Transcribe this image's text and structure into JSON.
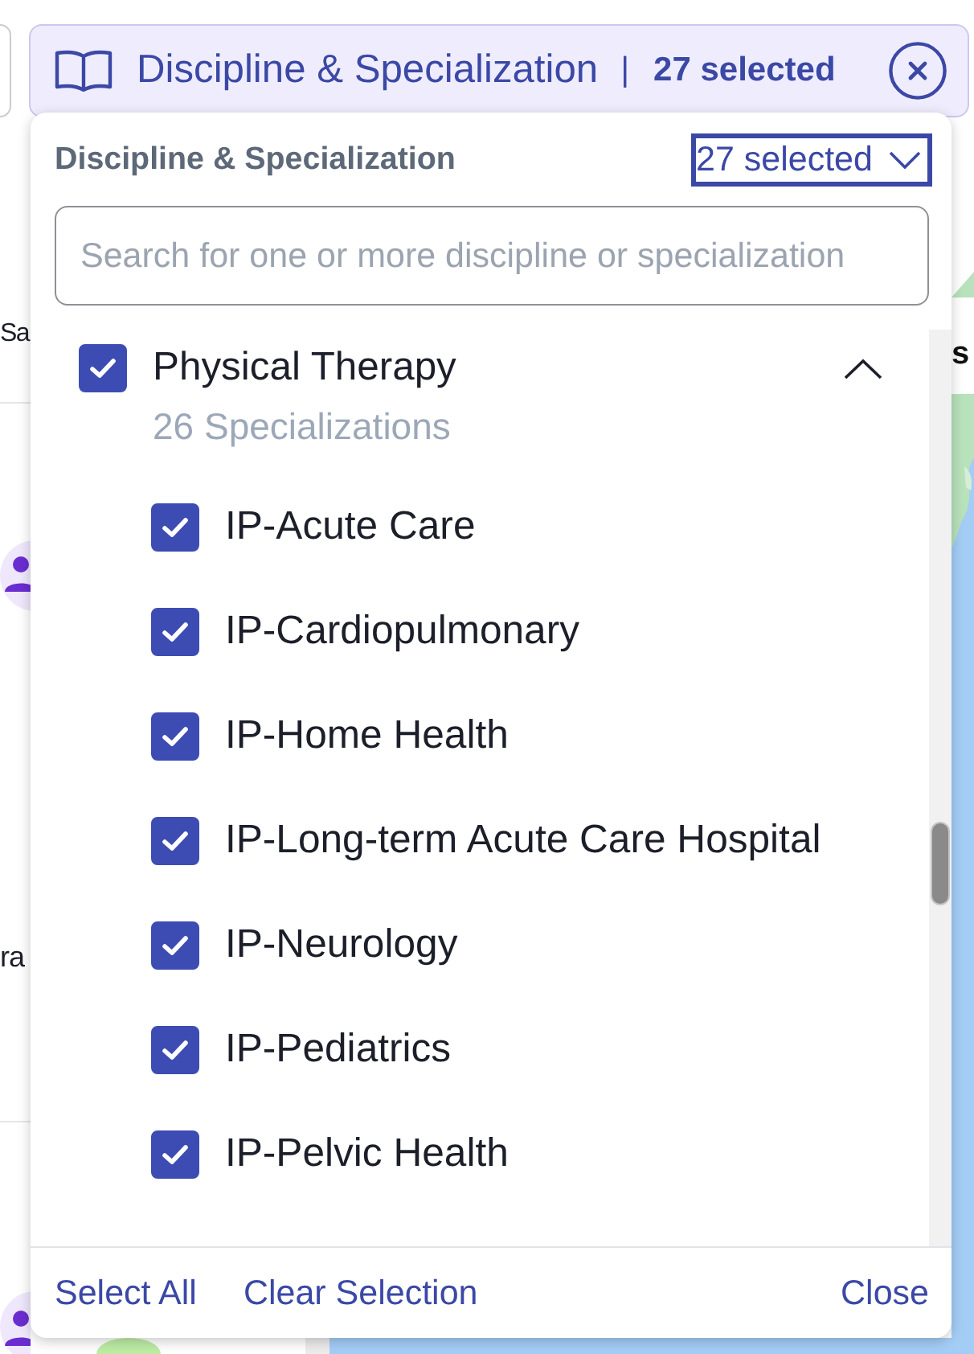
{
  "filter_chip": {
    "label": "Discipline & Specialization",
    "separator": "|",
    "count": "27 selected"
  },
  "background": {
    "left_texts": [
      "Sa",
      "ra"
    ],
    "right_text": "s"
  },
  "dropdown": {
    "title": "Discipline & Specialization",
    "count": "27 selected",
    "search": {
      "placeholder": "Search for one or more discipline or specialization"
    },
    "disciplines": [
      {
        "label": "Physical Therapy",
        "subtitle": "26 Specializations",
        "checked": true,
        "expanded": true,
        "children": [
          {
            "label": "IP-Acute Care",
            "checked": true
          },
          {
            "label": "IP-Cardiopulmonary",
            "checked": true
          },
          {
            "label": "IP-Home Health",
            "checked": true
          },
          {
            "label": "IP-Long-term Acute Care Hospital",
            "checked": true
          },
          {
            "label": "IP-Neurology",
            "checked": true
          },
          {
            "label": "IP-Pediatrics",
            "checked": true
          },
          {
            "label": "IP-Pelvic Health",
            "checked": true
          }
        ]
      }
    ],
    "footer": {
      "select_all": "Select All",
      "clear_selection": "Clear Selection",
      "close": "Close"
    }
  }
}
